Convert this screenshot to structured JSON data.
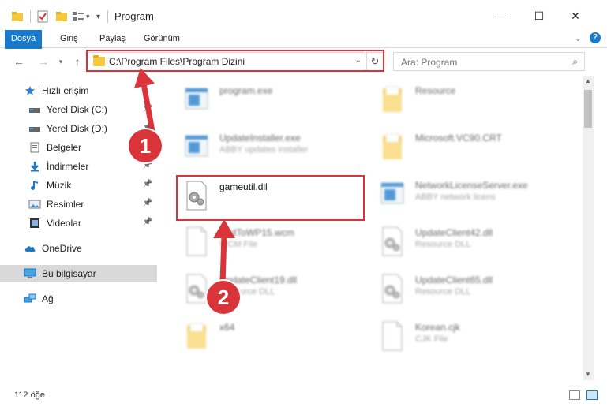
{
  "window": {
    "title": "Program",
    "minimize_glyph": "—",
    "maximize_glyph": "☐",
    "close_glyph": "✕"
  },
  "ribbon": {
    "tabs": [
      "Dosya",
      "Giriş",
      "Paylaş",
      "Görünüm"
    ]
  },
  "nav": {
    "address": "C:\\Program Files\\Program Dizini",
    "search_placeholder": "Ara: Program"
  },
  "sidebar": {
    "items": [
      {
        "label": "Hızlı erişim",
        "icon": "star-icon",
        "pinned": false
      },
      {
        "label": "Yerel Disk (C:)",
        "icon": "drive-icon",
        "pinned": true
      },
      {
        "label": "Yerel Disk (D:)",
        "icon": "drive-icon",
        "pinned": true
      },
      {
        "label": "Belgeler",
        "icon": "document-icon",
        "pinned": true
      },
      {
        "label": "İndirmeler",
        "icon": "download-icon",
        "pinned": true
      },
      {
        "label": "Müzik",
        "icon": "music-icon",
        "pinned": true
      },
      {
        "label": "Resimler",
        "icon": "picture-icon",
        "pinned": true
      },
      {
        "label": "Videolar",
        "icon": "video-icon",
        "pinned": true
      },
      {
        "label": "OneDrive",
        "icon": "cloud-icon",
        "pinned": false
      },
      {
        "label": "Bu bilgisayar",
        "icon": "computer-icon",
        "pinned": false,
        "selected": true
      },
      {
        "label": "Ağ",
        "icon": "network-icon",
        "pinned": false
      }
    ]
  },
  "files": [
    {
      "name": "program.exe",
      "desc": "",
      "icon": "exe-icon",
      "blurred": true
    },
    {
      "name": "Resource",
      "desc": "",
      "icon": "folder-icon",
      "blurred": true
    },
    {
      "name": "UpdateInstaller.exe",
      "desc": "ABBY updates installer",
      "icon": "exe-icon",
      "blurred": true
    },
    {
      "name": "Microsoft.VC90.CRT",
      "desc": "",
      "icon": "folder-icon",
      "blurred": true
    },
    {
      "name": "gameutil.dll",
      "desc": "",
      "icon": "dll-icon",
      "blurred": false
    },
    {
      "name": "NetworkLicenseServer.exe",
      "desc": "ABBY network licens",
      "icon": "exe-icon",
      "blurred": true
    },
    {
      "name": "AddToWP15.wcm",
      "desc": "WCM File",
      "icon": "file-icon",
      "blurred": true
    },
    {
      "name": "UpdateClient42.dll",
      "desc": "Resource DLL",
      "icon": "dll-icon",
      "blurred": true
    },
    {
      "name": "UpdateClient19.dll",
      "desc": "Resource DLL",
      "icon": "dll-icon",
      "blurred": true
    },
    {
      "name": "UpdateClient65.dll",
      "desc": "Resource DLL",
      "icon": "dll-icon",
      "blurred": true
    },
    {
      "name": "x64",
      "desc": "",
      "icon": "folder-icon",
      "blurred": true
    },
    {
      "name": "Korean.cjk",
      "desc": "CJK File",
      "icon": "file-icon",
      "blurred": true
    }
  ],
  "status": {
    "item_count": "112 öğe"
  },
  "annotations": {
    "step1": "1",
    "step2": "2",
    "color": "#d9343a"
  }
}
